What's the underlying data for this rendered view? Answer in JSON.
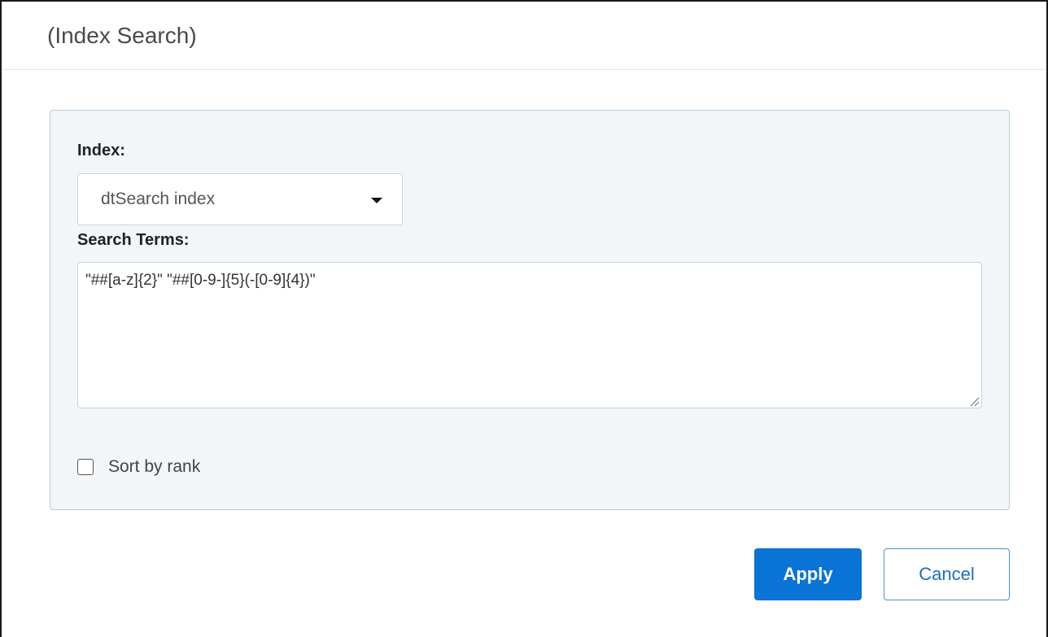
{
  "dialog": {
    "title": "(Index Search)"
  },
  "form": {
    "index_label": "Index:",
    "index_value": "dtSearch index",
    "terms_label": "Search Terms:",
    "terms_value": "\"##[a-z]{2}\" \"##[0-9-]{5}(-[0-9]{4})\"",
    "sort_label": "Sort by rank",
    "sort_checked": false
  },
  "buttons": {
    "apply_label": "Apply",
    "cancel_label": "Cancel"
  },
  "colors": {
    "accent": "#0a73d6",
    "panel_bg": "#f2f6f9",
    "panel_border": "#b9cbd9"
  },
  "icons": {
    "caret": "caret-down-icon",
    "resize": "resize-grip-icon"
  }
}
